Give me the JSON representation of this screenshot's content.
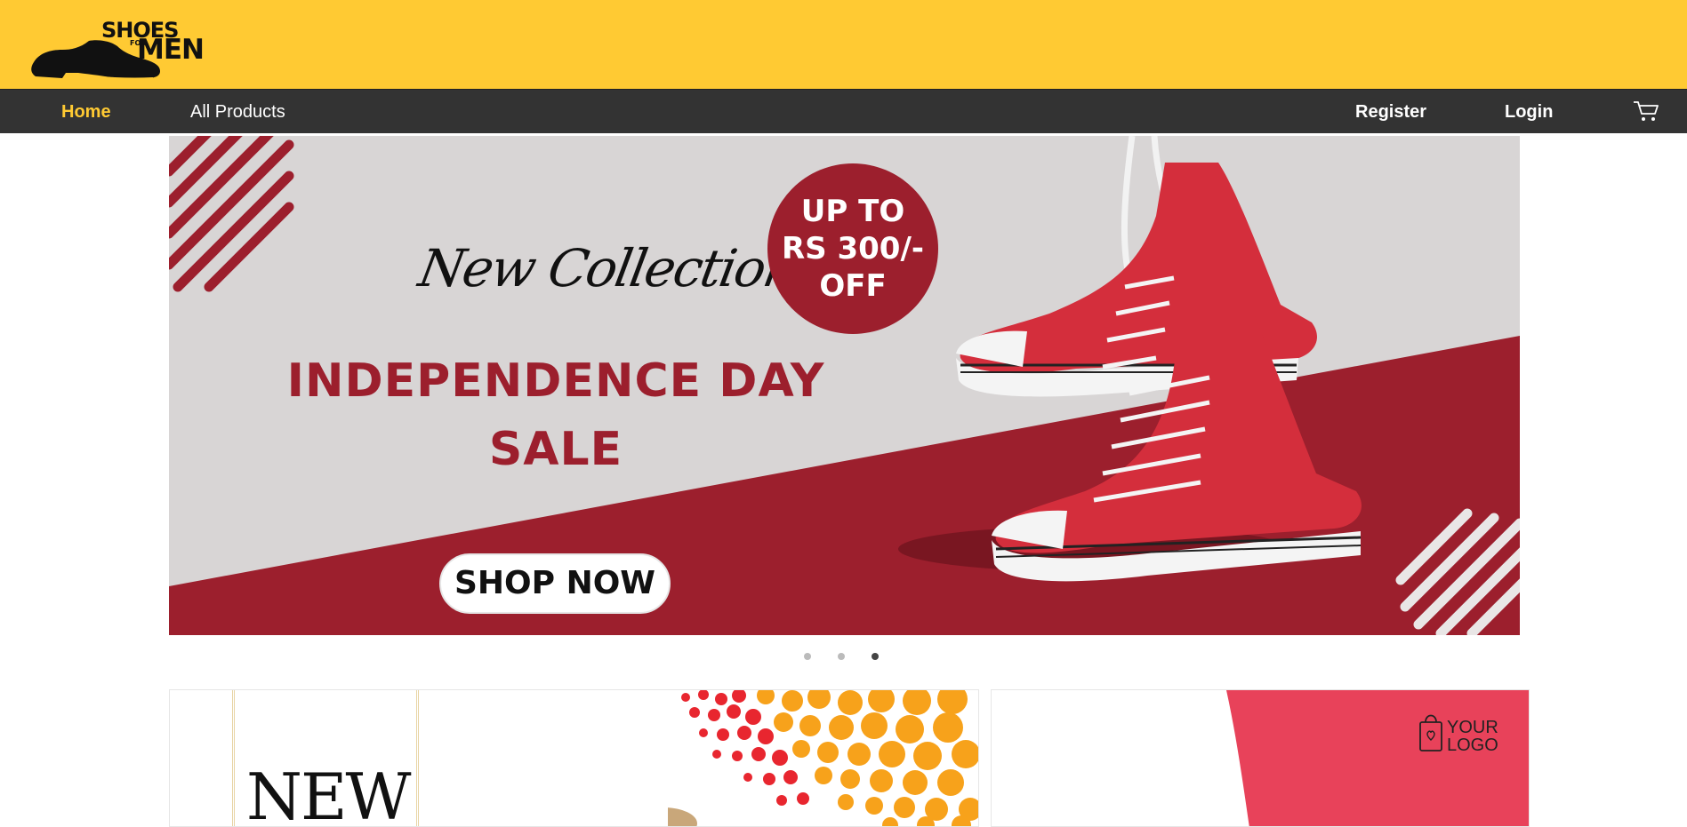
{
  "brand": {
    "line1": "SHOES",
    "line2": "FOR",
    "line3": "MEN",
    "icon": "shoe-icon"
  },
  "nav": {
    "home": "Home",
    "all_products": "All Products",
    "register": "Register",
    "login": "Login",
    "cart_icon": "cart-icon"
  },
  "banner": {
    "subtitle": "New Collection",
    "headline_line1": "INDEPENDENCE DAY",
    "headline_line2": "SALE",
    "offer_line1": "UP TO",
    "offer_line2": "RS 300/-",
    "offer_line3": "OFF",
    "cta": "SHOP NOW",
    "image": "red-sneakers-image"
  },
  "carousel": {
    "slides": 3,
    "active_slide": 3
  },
  "cards": {
    "left_text": "NEW",
    "right_logo_line1": "YOUR",
    "right_logo_line2": "LOGO"
  },
  "colors": {
    "topbar": "#ffca33",
    "navbar": "#333333",
    "nav_active": "#ffca33",
    "banner_red": "#9c1f2d",
    "banner_grey": "#d8d5d5",
    "card_pink": "#e8425a"
  }
}
